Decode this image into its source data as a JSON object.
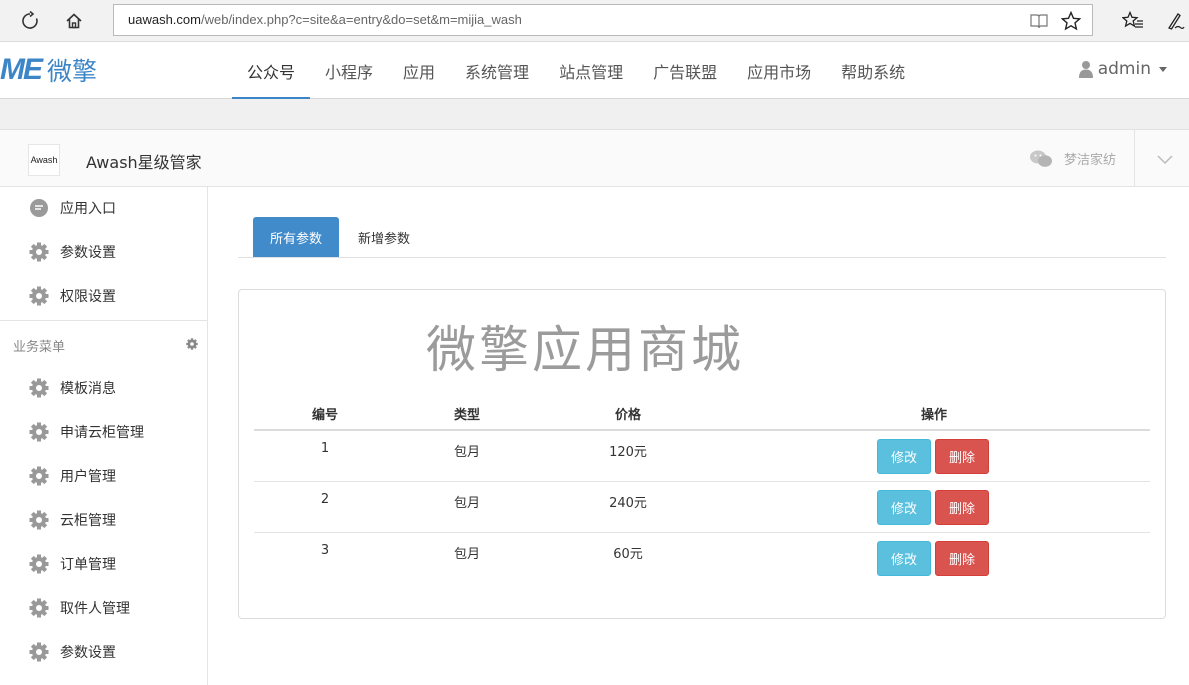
{
  "browser": {
    "url_host": "uawash.com",
    "url_path": "/web/index.php?c=site&a=entry&do=set&m=mijia_wash"
  },
  "topnav": {
    "logo_mark": "ME",
    "logo_text": "微擎",
    "items": [
      {
        "label": "公众号",
        "active": true
      },
      {
        "label": "小程序"
      },
      {
        "label": "应用"
      },
      {
        "label": "系统管理"
      },
      {
        "label": "站点管理"
      },
      {
        "label": "广告联盟"
      },
      {
        "label": "应用市场"
      },
      {
        "label": "帮助系统"
      }
    ],
    "user": "admin"
  },
  "account": {
    "logo_text": "Awash",
    "name": "Awash星级管家",
    "wechat_name": "梦洁家纺"
  },
  "sidebar": {
    "top_items": [
      {
        "label": "应用入口",
        "icon": "chat-icon"
      },
      {
        "label": "参数设置",
        "icon": "gear-icon"
      },
      {
        "label": "权限设置",
        "icon": "gear-icon"
      }
    ],
    "section_title": "业务菜单",
    "business_items": [
      {
        "label": "模板消息"
      },
      {
        "label": "申请云柜管理"
      },
      {
        "label": "用户管理"
      },
      {
        "label": "云柜管理"
      },
      {
        "label": "订单管理"
      },
      {
        "label": "取件人管理"
      },
      {
        "label": "参数设置"
      }
    ]
  },
  "main": {
    "tabs": [
      {
        "label": "所有参数",
        "active": true
      },
      {
        "label": "新增参数"
      }
    ],
    "watermark": "微擎应用商城",
    "table": {
      "headers": [
        "编号",
        "类型",
        "价格",
        "操作"
      ],
      "rows": [
        {
          "id": "1",
          "type": "包月",
          "price": "120元"
        },
        {
          "id": "2",
          "type": "包月",
          "price": "240元"
        },
        {
          "id": "3",
          "type": "包月",
          "price": "60元"
        }
      ],
      "edit_label": "修改",
      "delete_label": "删除"
    }
  },
  "colors": {
    "brand": "#3c86c8",
    "primary": "#428bca",
    "info": "#5bc0de",
    "danger": "#d9534f"
  }
}
